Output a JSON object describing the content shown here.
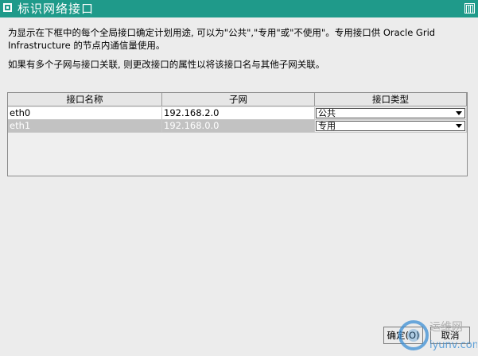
{
  "window": {
    "title": "标识网络接口"
  },
  "description": {
    "line1": "为显示在下框中的每个全局接口确定计划用途, 可以为\"公共\",\"专用\"或\"不使用\"。专用接口供 Oracle Grid",
    "line2": "Infrastructure 的节点内通信量使用。",
    "line3": "如果有多个子网与接口关联, 则更改接口的属性以将该接口名与其他子网关联。"
  },
  "table": {
    "headers": [
      "接口名称",
      "子网",
      "接口类型"
    ],
    "rows": [
      {
        "name": "eth0",
        "subnet": "192.168.2.0",
        "type": "公共",
        "selected": false
      },
      {
        "name": "eth1",
        "subnet": "192.168.0.0",
        "type": "专用",
        "selected": true
      }
    ]
  },
  "buttons": {
    "ok": "确定(O)",
    "cancel": "取消"
  },
  "watermark": {
    "brand": "运维网",
    "url": "iyunv.com"
  }
}
